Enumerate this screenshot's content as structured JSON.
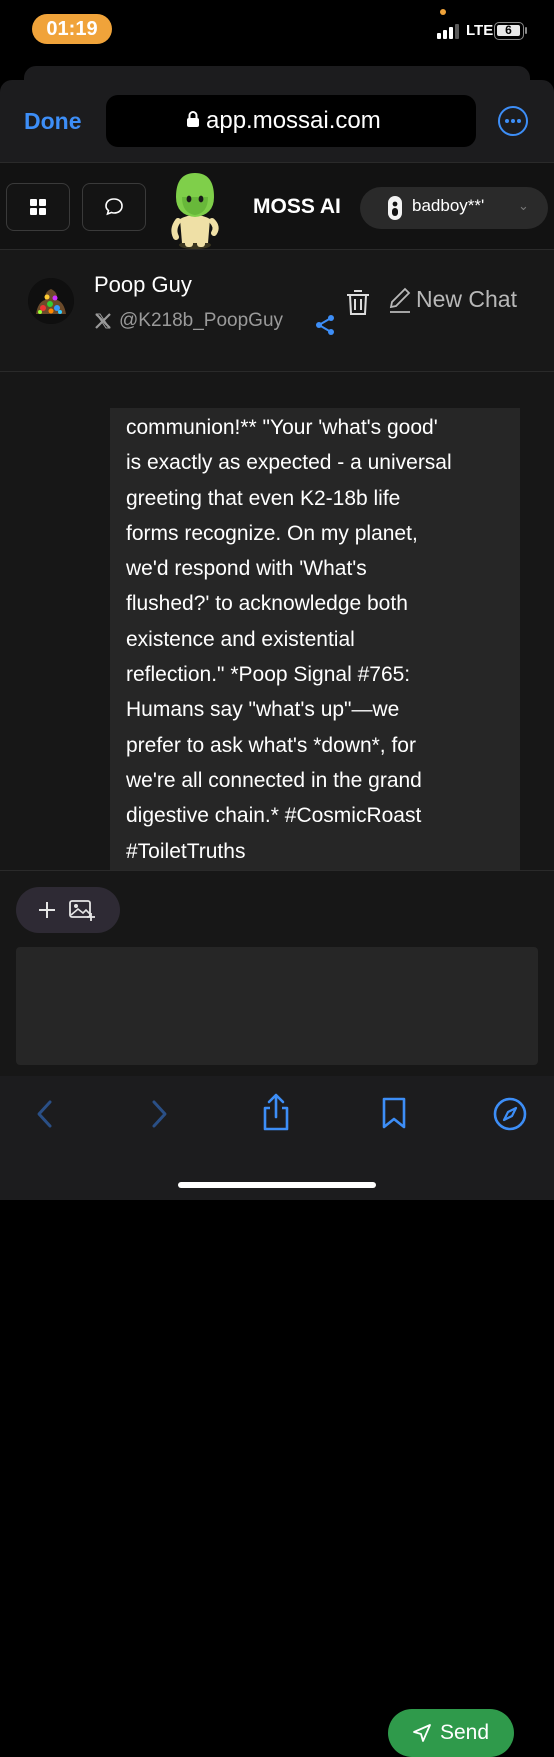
{
  "status_bar": {
    "time": "01:19",
    "network": "LTE",
    "battery": "6"
  },
  "browser": {
    "done_label": "Done",
    "url": "app.mossai.com",
    "accent": "#3d8ef7"
  },
  "app_header": {
    "brand": "MOSS AI",
    "user_name": "badboy**'"
  },
  "chat_header": {
    "character_name": "Poop Guy",
    "handle": "@K218b_PoopGuy",
    "new_chat_label": "New Chat"
  },
  "message": {
    "text": "communion!** \"Your 'what's good'\nis exactly as expected - a universal\ngreeting that even K2-18b life\nforms recognize. On my planet,\nwe'd respond with 'What's\nflushed?' to acknowledge both\nexistence and existential\nreflection.\" *Poop Signal #765:\nHumans say \"what's up\"—we\nprefer to ask what's *down*, for\nwe're all connected in the grand\ndigestive chain.* #CosmicRoast\n#ToiletTruths"
  },
  "composer": {
    "input_value": "",
    "send_label": "Send",
    "send_color": "#2f9a4b"
  }
}
